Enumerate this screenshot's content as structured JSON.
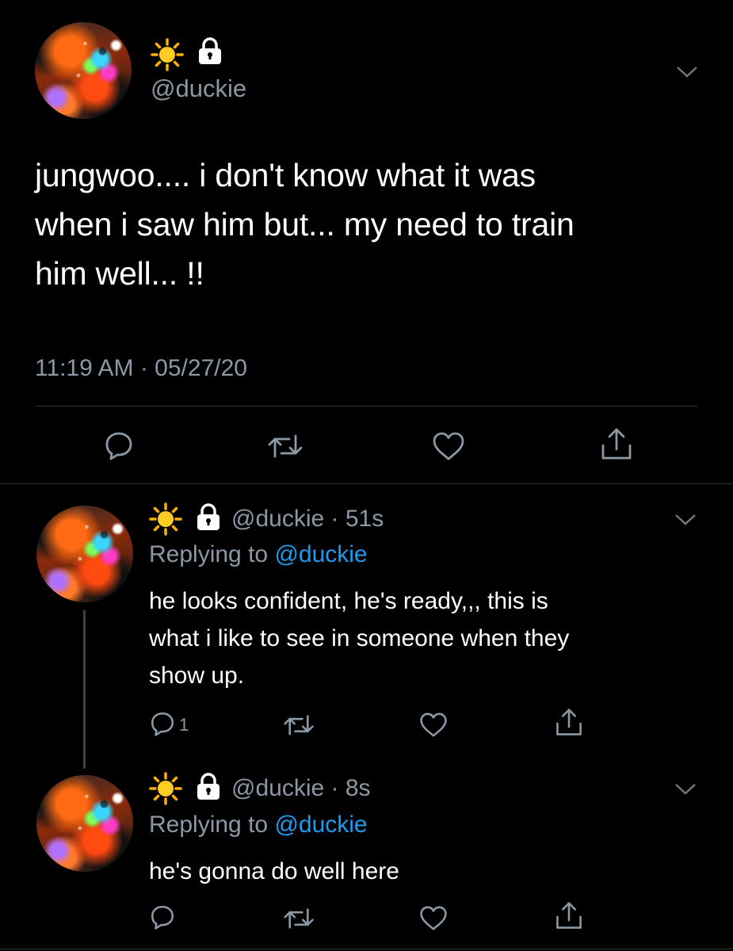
{
  "main_tweet": {
    "name_emoji": [
      "sun",
      "lock"
    ],
    "handle": "@duckie",
    "text_lines": [
      "jungwoo.... i don't know what it was",
      "when i saw him but...  my need to train",
      "him well... !!"
    ],
    "timestamp": "11:19 AM · 05/27/20"
  },
  "replies": [
    {
      "handle_time": "@duckie · 51s",
      "replying_prefix": "Replying to ",
      "replying_to": "@duckie",
      "text_lines": [
        "he looks confident, he's ready,,, this is",
        "what i like to see in someone when they",
        "show up."
      ],
      "reply_count": "1"
    },
    {
      "handle_time": "@duckie · 8s",
      "replying_prefix": "Replying to ",
      "replying_to": "@duckie",
      "text_lines": [
        "he's gonna do well here"
      ],
      "reply_count": ""
    }
  ],
  "colors": {
    "background": "#000000",
    "muted": "#8b98a5",
    "link": "#1d9bf0",
    "divider": "#2f3336"
  },
  "icons": [
    "sun-icon",
    "lock-icon",
    "chevron-down-icon",
    "reply-icon",
    "retweet-icon",
    "like-icon",
    "share-icon"
  ]
}
